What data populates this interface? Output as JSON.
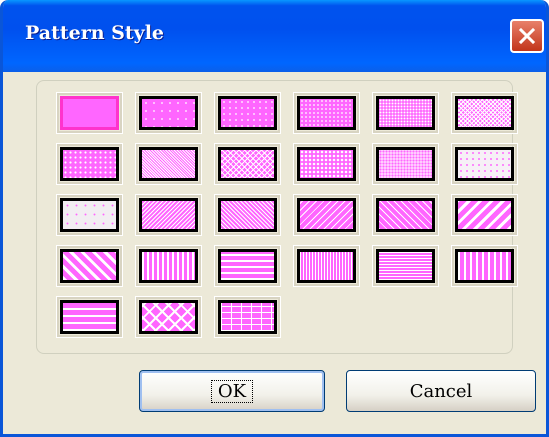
{
  "window": {
    "title": "Pattern Style"
  },
  "buttons": {
    "ok": "OK",
    "cancel": "Cancel"
  },
  "colors": {
    "pattern_fg": "#ffffff",
    "pattern_bg": "#ff66ff",
    "selected_border": "#ff33cc"
  },
  "patterns": [
    {
      "name": "solid",
      "selected": true
    },
    {
      "name": "dots-sparse-1"
    },
    {
      "name": "dots-sparse-2"
    },
    {
      "name": "dots-medium"
    },
    {
      "name": "dots-dense"
    },
    {
      "name": "grid-fine"
    },
    {
      "name": "dots-25"
    },
    {
      "name": "dots-50"
    },
    {
      "name": "diag-cross-fine"
    },
    {
      "name": "dots-grid-coarse"
    },
    {
      "name": "dots-light"
    },
    {
      "name": "dots-very-light"
    },
    {
      "name": "dots-lightest"
    },
    {
      "name": "diag-down-thin"
    },
    {
      "name": "diag-up-thin"
    },
    {
      "name": "diag-down-wide"
    },
    {
      "name": "diag-up-wide"
    },
    {
      "name": "diag-down-thick"
    },
    {
      "name": "diag-up-thick"
    },
    {
      "name": "vertical-thin"
    },
    {
      "name": "horizontal-thin"
    },
    {
      "name": "vertical-dense"
    },
    {
      "name": "horizontal-dense"
    },
    {
      "name": "vertical-thick"
    },
    {
      "name": "horizontal-thick"
    },
    {
      "name": "diag-cross-thick"
    },
    {
      "name": "bricks"
    }
  ]
}
